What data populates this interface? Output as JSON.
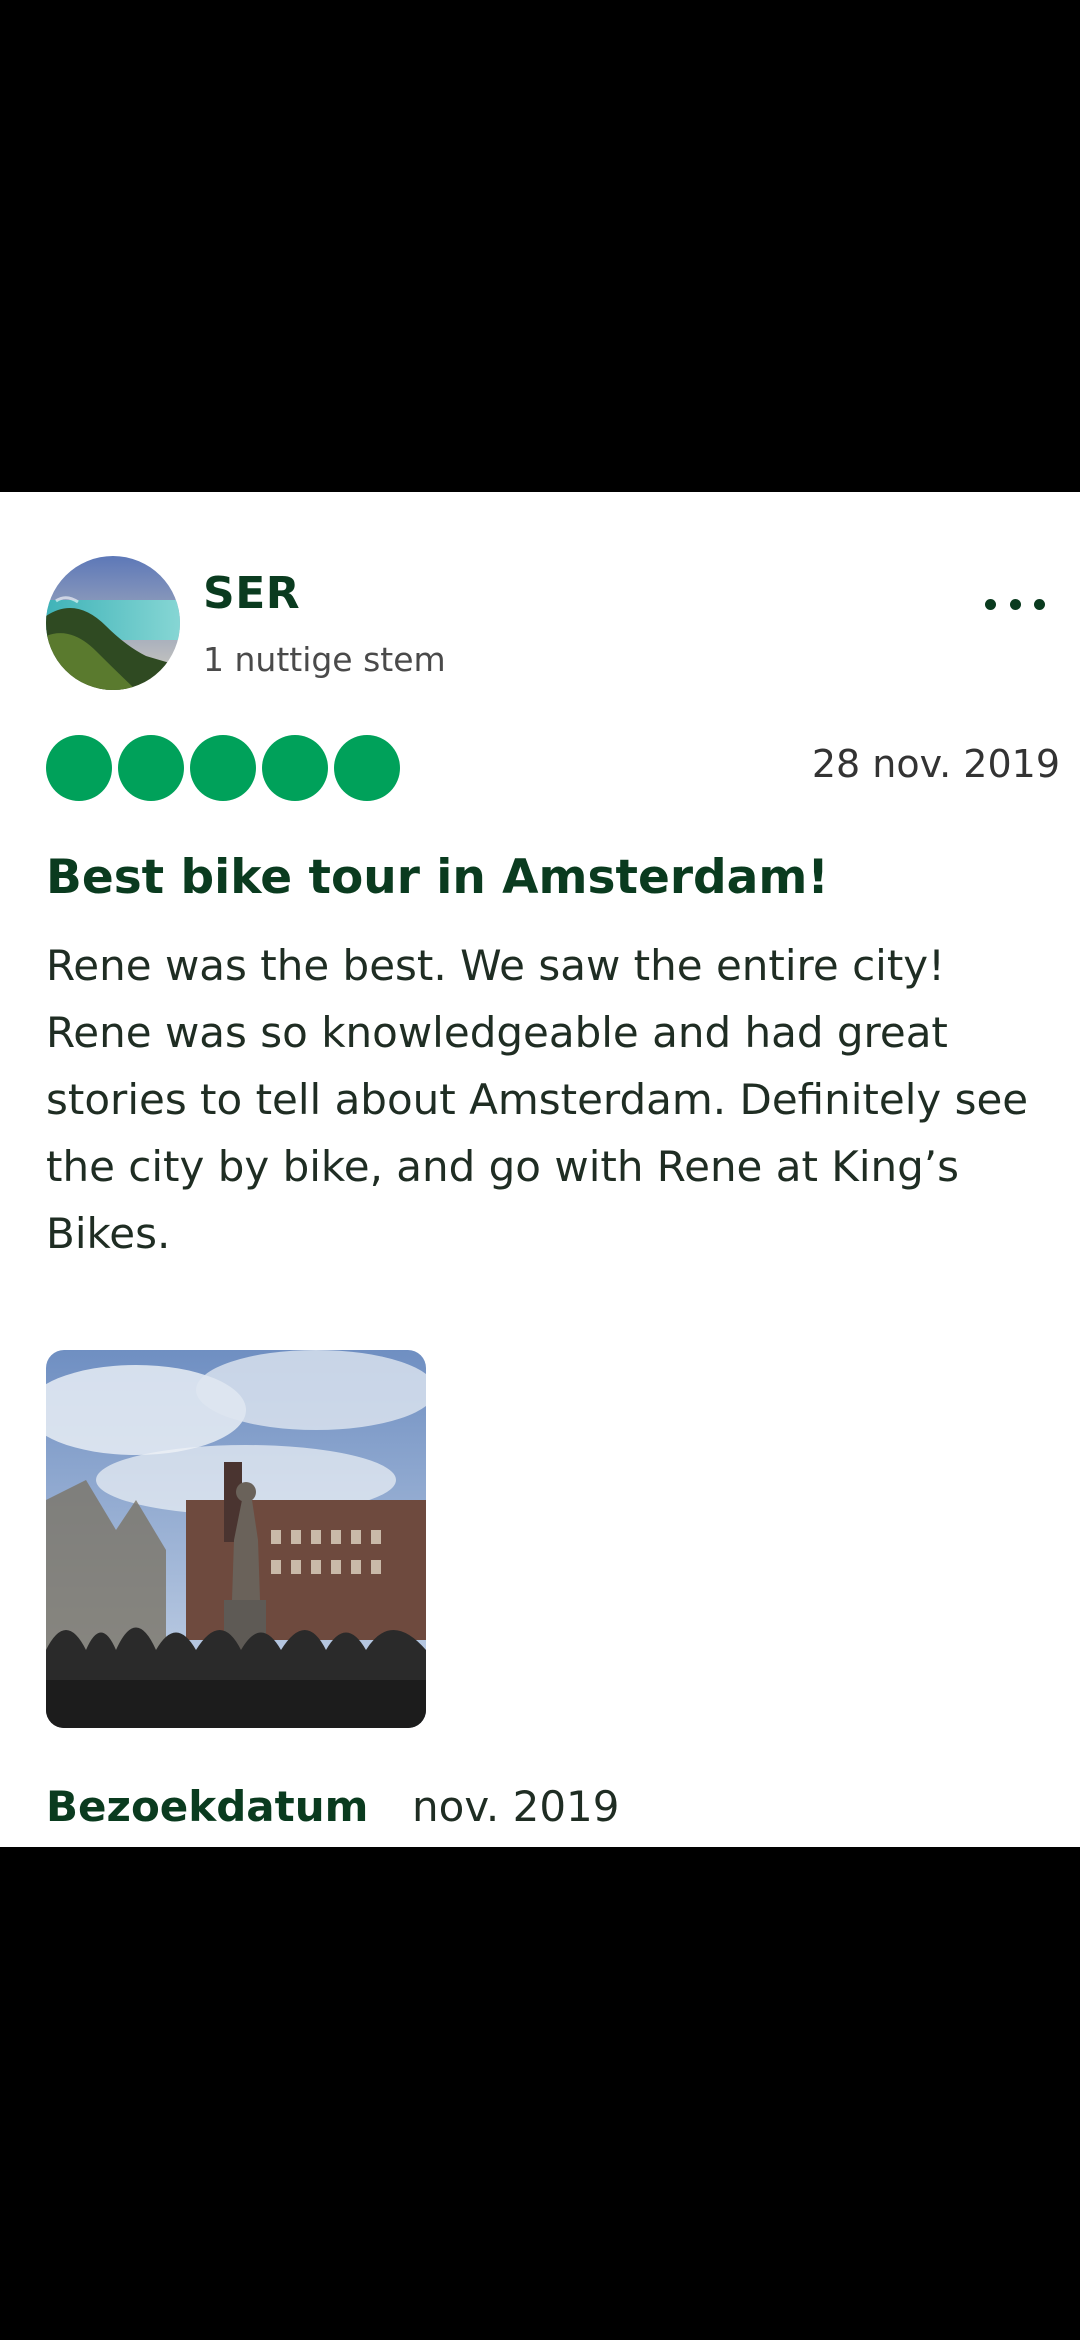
{
  "review": {
    "author": "SER",
    "helpful_votes": "1 nuttige stem",
    "rating": 5,
    "rating_max": 5,
    "date": "28 nov. 2019",
    "title": "Best bike tour in Amsterdam!",
    "body": "Rene was the best. We saw the entire city! Rene was so knowledgeable and had great stories to tell about Amsterdam. Definitely see the city by bike, and go with Rene at King’s Bikes.",
    "visit_label": "Bezoekdatum",
    "visit_value": "nov. 2019"
  },
  "icons": {
    "more": "more-options-icon"
  },
  "colors": {
    "bubble": "#00a15a",
    "heading": "#0a3b1f"
  }
}
